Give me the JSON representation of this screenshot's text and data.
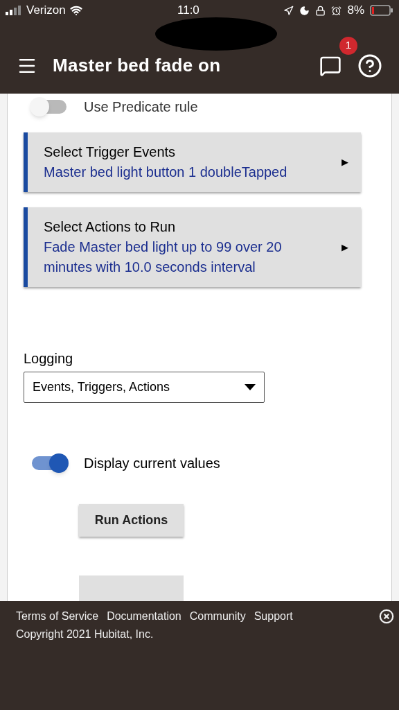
{
  "status_bar": {
    "carrier": "Verizon",
    "time": "11:0",
    "battery": "8%"
  },
  "app_bar": {
    "title": "Master bed fade on",
    "notification_count": "1"
  },
  "predicate_toggle": {
    "label": "Use Predicate rule",
    "on": false
  },
  "sections": [
    {
      "title": "Select Trigger Events",
      "summary": "Master bed light button 1 doubleTapped",
      "arrow": "▶"
    },
    {
      "title": "Select Actions to Run",
      "summary": "Fade Master bed light up to 99 over 20 minutes with 10.0 seconds interval",
      "arrow": "▶"
    }
  ],
  "logging": {
    "label": "Logging",
    "value": "Events, Triggers, Actions"
  },
  "display_toggle": {
    "label": "Display current values",
    "on": true
  },
  "run_button": {
    "label": "Run Actions"
  },
  "footer": {
    "links": [
      "Terms of Service",
      "Documentation",
      "Community",
      "Support"
    ],
    "copyright": "Copyright 2021 Hubitat, Inc."
  }
}
